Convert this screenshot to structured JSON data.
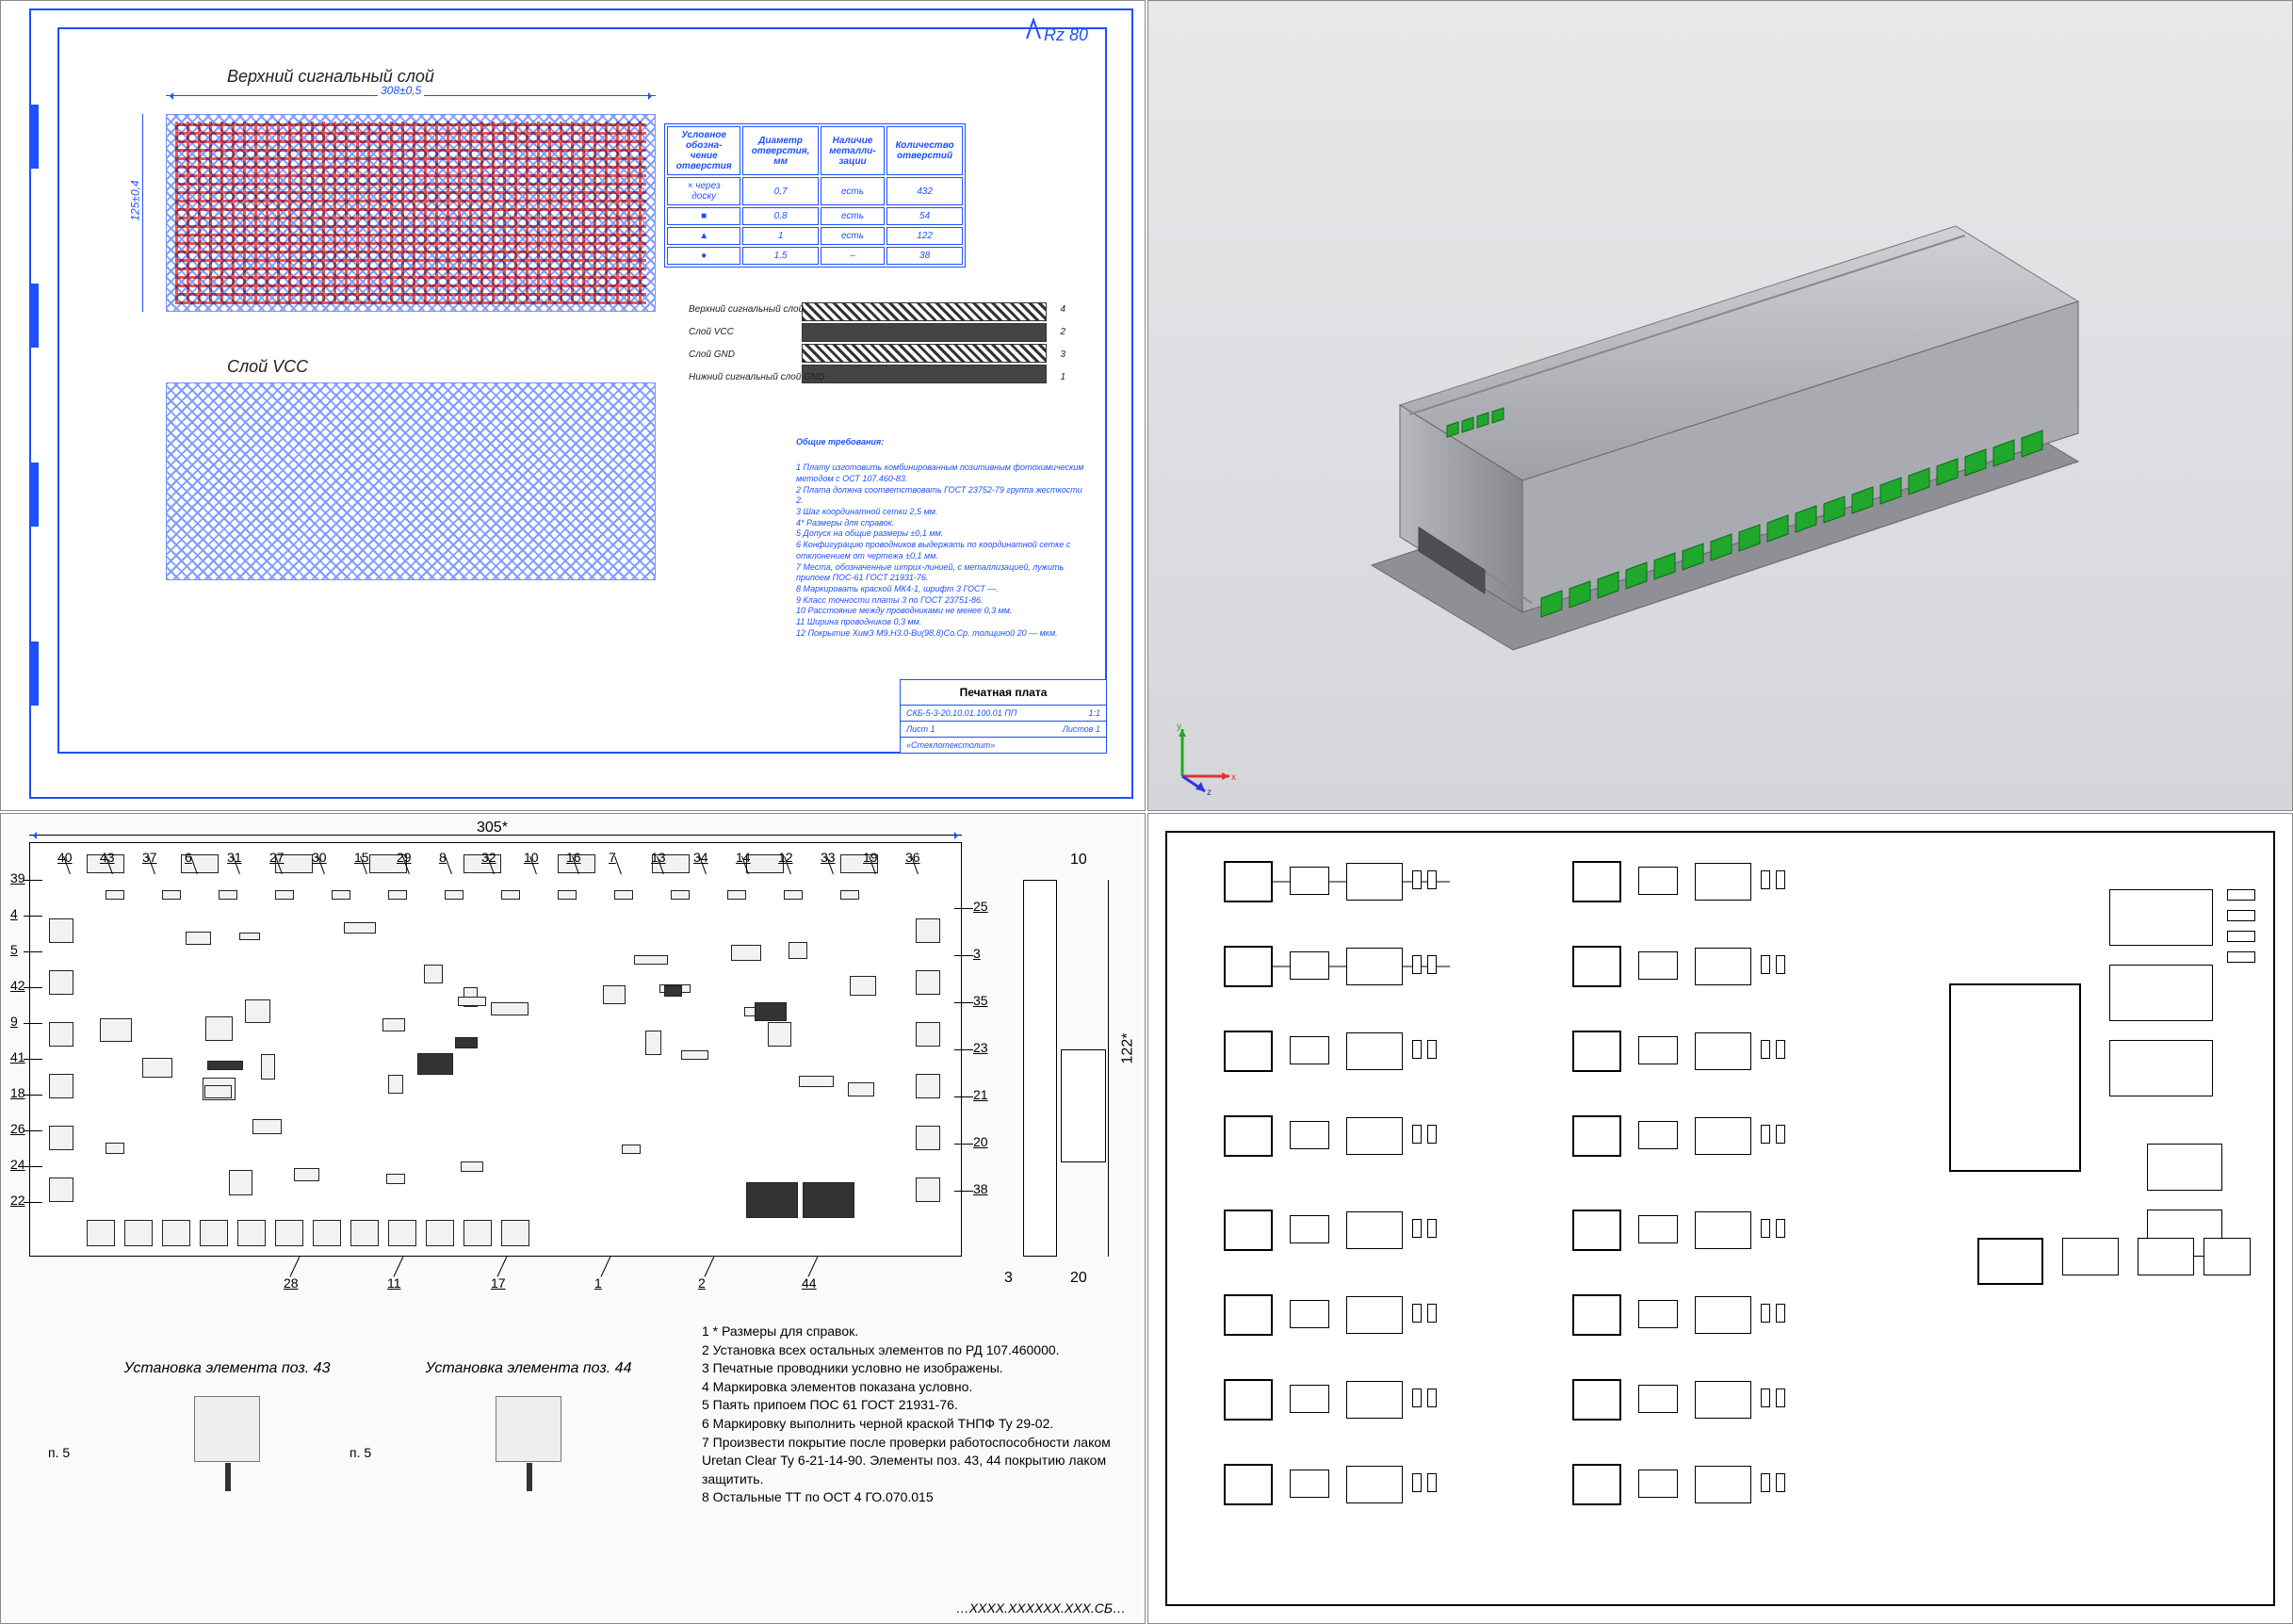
{
  "top_left": {
    "rz_label": "Rz 80",
    "title_top": "Верхний сигнальный слой",
    "title_vcc": "Слой VCC",
    "dim_width": "308±0,5",
    "dim_height": "125±0,4",
    "table": {
      "headers": [
        "Условное обозна-чение отверстия",
        "Диаметр отверстия, мм",
        "Наличие металли-зации",
        "Количество отверстий"
      ],
      "rows": [
        [
          "× через доску",
          "0,7",
          "есть",
          "432"
        ],
        [
          "■",
          "0,8",
          "есть",
          "54"
        ],
        [
          "▲",
          "1",
          "есть",
          "122"
        ],
        [
          "●",
          "1,5",
          "–",
          "38"
        ]
      ]
    },
    "stack_labels": [
      "Верхний сигнальный слой",
      "Слой VCC",
      "Слой GND",
      "Нижний сигнальный слой GND"
    ],
    "stack_numbers": [
      "4",
      "2",
      "3",
      "1"
    ],
    "notes_title": "Общие требования:",
    "notes": "1 Плату изготовить комбинированным позитивным фотохимическим методом с ОСТ 107.460-83.\n2 Плата должна соответствовать ГОСТ 23752-79 группа жесткости 2.\n3 Шаг координатной сетки 2,5 мм.\n4* Размеры для справок.\n5 Допуск на общие размеры ±0,1 мм.\n6 Конфигурацию проводников выдержать по координатной сетке с отклонением от чертежа ±0,1 мм.\n7 Места, обозначенные штрих-линией, с металлизацией, лужить припоем ПОС-61 ГОСТ 21931-76.\n8 Маркировать краской МК4-1, шрифт 3 ГОСТ —.\n9 Класс точности платы 3 по ГОСТ 23751-86.\n10 Расстояние между проводниками не менее 0,3 мм.\n11 Ширина проводников 0,3 мм.\n12 Покрытие ХимЗ М9.Н3.0-Ви(98,8)Со.Ср. толщиной 20 — мкм.",
    "title_block": {
      "title": "Печатная плата",
      "doc_no": "СКБ-5-3-20.10.01.100.01 ПП",
      "scale": "1:1",
      "sheet": "Лист 1",
      "sheets": "Листов 1",
      "material": "«Стеклотекстолит»"
    }
  },
  "top_right": {
    "axes": {
      "x": "x",
      "y": "y",
      "z": "z"
    }
  },
  "bottom_left": {
    "dim_width": "305*",
    "dim_height": "122*",
    "side_gap": "3",
    "side_h": "10",
    "side_h2": "20",
    "callouts_top": [
      "40",
      "43",
      "37",
      "6",
      "31",
      "27",
      "30",
      "15",
      "29",
      "8",
      "32",
      "10",
      "16",
      "7",
      "13",
      "34",
      "14",
      "12",
      "33",
      "19",
      "36"
    ],
    "callouts_left": [
      "39",
      "4",
      "5",
      "42",
      "9",
      "41",
      "18",
      "26",
      "24",
      "22"
    ],
    "callouts_right": [
      "25",
      "3",
      "35",
      "23",
      "21",
      "20",
      "38"
    ],
    "callouts_bottom": [
      "28",
      "11",
      "17",
      "1",
      "2",
      "44"
    ],
    "detail43_label": "Установка элемента поз. 43",
    "detail44_label": "Установка элемента поз. 44",
    "p5": "п. 5",
    "notes": "1 * Размеры для справок.\n2 Установка всех остальных элементов по РД 107.460000.\n3 Печатные проводники условно не изображены.\n4 Маркировка элементов показана условно.\n5 Паять припоем ПОС 61 ГОСТ 21931-76.\n6 Маркировку выполнить черной краской ТНПФ Ту 29-02.\n7 Произвести покрытие после проверки работоспособности лаком Uretan Clear Ту 6-21-14-90. Элементы поз. 43, 44 покрытию лаком защитить.\n8 Остальные ТТ по ОСТ 4 ГО.070.015",
    "doc_no": "…ХХХХ.ХХХХХХ.ХХХ.СБ…"
  },
  "bottom_right": {
    "repeated_channel_count": 16
  }
}
